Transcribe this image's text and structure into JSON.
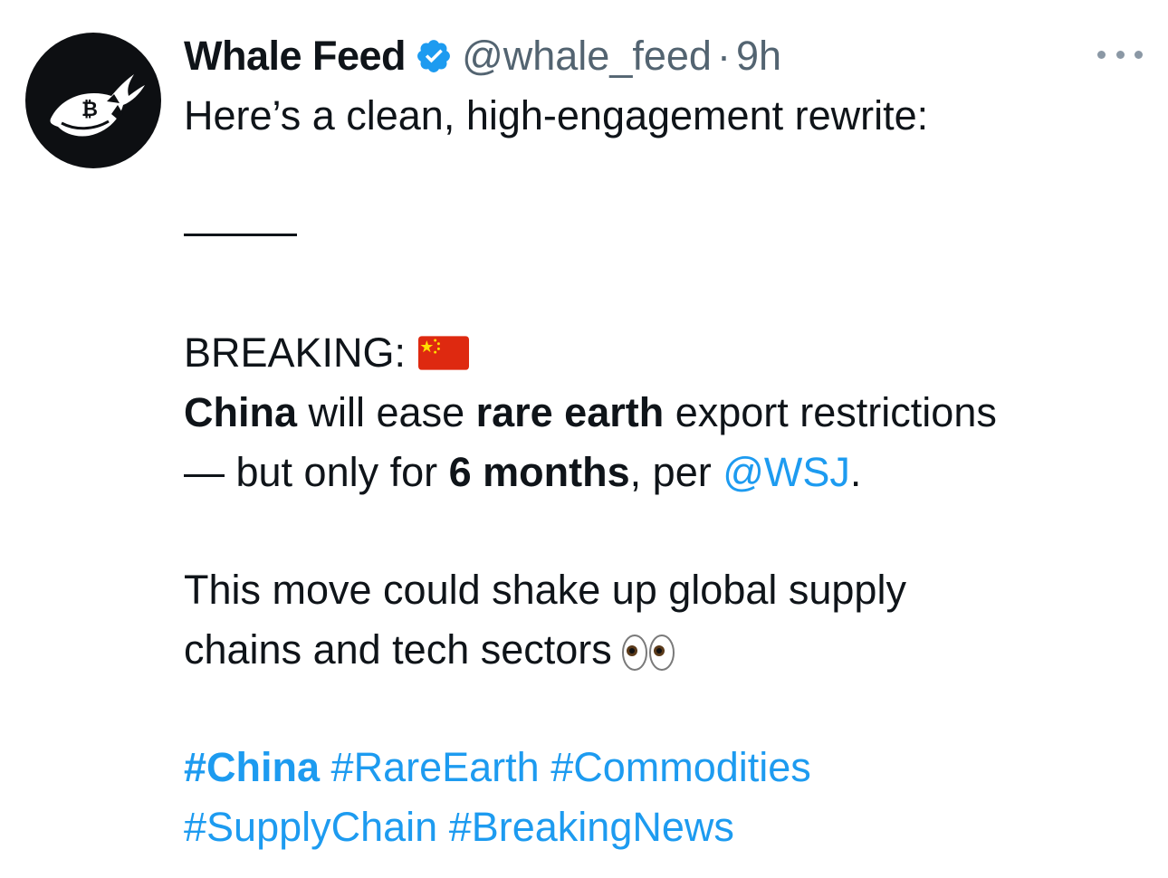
{
  "tweet": {
    "author": {
      "display_name": "Whale Feed",
      "handle": "@whale_feed",
      "separator": "·",
      "time": "9h",
      "avatar_icon": "whale-bitcoin-logo",
      "verified_icon": "verified-badge-icon"
    },
    "intro": "Here’s a clean, high-engagement rewrite:",
    "divider": "——",
    "breaking_label": "BREAKING:",
    "flag_icon": "china-flag-icon",
    "line1": {
      "china": "China",
      "will_ease": " will ease ",
      "rare_earth": "rare earth",
      "rest": " export restrictions"
    },
    "line2": {
      "dash": "— but only for ",
      "months": "6 months",
      "per": ", per ",
      "mention": "@WSJ",
      "period": "."
    },
    "line3": "This move could shake up global supply",
    "line4": "chains and tech sectors",
    "eyes_icon": "eyes-emoji-icon",
    "hashtags": {
      "china": "#China",
      "rare_earth": "#RareEarth",
      "commodities": "#Commodities",
      "supply_chain": "#SupplyChain",
      "breaking_news": "#BreakingNews"
    },
    "more_icon": "more-options-icon"
  },
  "colors": {
    "text": "#0f1419",
    "secondary": "#536471",
    "link": "#1d9bf0",
    "verified": "#1d9bf0"
  }
}
